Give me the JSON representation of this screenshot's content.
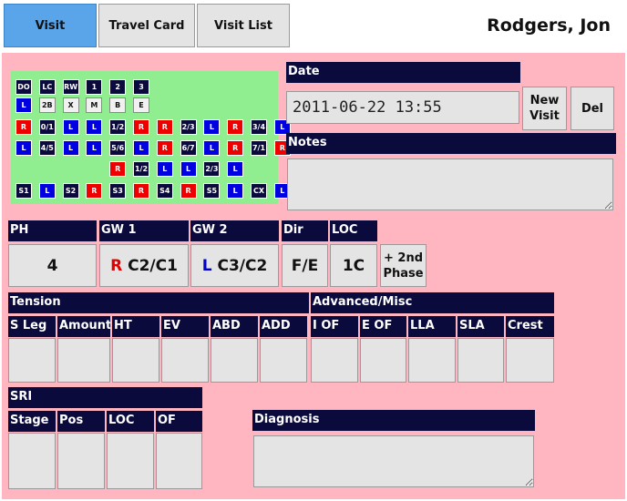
{
  "tabs": [
    {
      "label": "Visit",
      "active": true
    },
    {
      "label": "Travel Card",
      "active": false
    },
    {
      "label": "Visit List",
      "active": false
    }
  ],
  "patient_name": "Rodgers, Jon",
  "colors": {
    "accent": "#5aa5ea",
    "panel_bg": "#ffb6c1",
    "header_bg": "#0a0a3c",
    "grid_bg": "#90ee90",
    "red": "#ee0000",
    "blue": "#0000e0"
  },
  "grid": {
    "rows": [
      [
        {
          "t": "DO",
          "c": "k"
        },
        {
          "t": "LC",
          "c": "k"
        },
        {
          "t": "RW",
          "c": "k"
        },
        {
          "t": "1",
          "c": "k"
        },
        {
          "t": "2",
          "c": "k"
        },
        {
          "t": "3",
          "c": "k"
        }
      ],
      [
        {
          "t": "L",
          "c": "b"
        },
        {
          "t": "2B",
          "c": "w"
        },
        {
          "t": "X",
          "c": "w"
        },
        {
          "t": "M",
          "c": "w"
        },
        {
          "t": "B",
          "c": "w"
        },
        {
          "t": "E",
          "c": "w"
        }
      ],
      [
        {
          "t": "R",
          "c": "r"
        },
        {
          "t": "0/1",
          "c": "k"
        },
        {
          "t": "L",
          "c": "b"
        },
        {
          "t": "L",
          "c": "b"
        },
        {
          "t": "1/2",
          "c": "k"
        },
        {
          "t": "R",
          "c": "r"
        },
        {
          "t": "R",
          "c": "r"
        },
        {
          "t": "2/3",
          "c": "k"
        },
        {
          "t": "L",
          "c": "b"
        },
        {
          "t": "R",
          "c": "r"
        },
        {
          "t": "3/4",
          "c": "k"
        },
        {
          "t": "L",
          "c": "b"
        }
      ],
      [
        {
          "t": "L",
          "c": "b"
        },
        {
          "t": "4/5",
          "c": "k"
        },
        {
          "t": "L",
          "c": "b"
        },
        {
          "t": "L",
          "c": "b"
        },
        {
          "t": "5/6",
          "c": "k"
        },
        {
          "t": "L",
          "c": "b"
        },
        {
          "t": "R",
          "c": "r"
        },
        {
          "t": "6/7",
          "c": "k"
        },
        {
          "t": "L",
          "c": "b"
        },
        {
          "t": "R",
          "c": "r"
        },
        {
          "t": "7/1",
          "c": "k"
        },
        {
          "t": "R",
          "c": "r"
        }
      ],
      [
        {
          "t": "",
          "c": "none"
        },
        {
          "t": "",
          "c": "none"
        },
        {
          "t": "",
          "c": "none"
        },
        {
          "t": "",
          "c": "none"
        },
        {
          "t": "R",
          "c": "r"
        },
        {
          "t": "1/2",
          "c": "k"
        },
        {
          "t": "L",
          "c": "b"
        },
        {
          "t": "L",
          "c": "b"
        },
        {
          "t": "2/3",
          "c": "k"
        },
        {
          "t": "L",
          "c": "b"
        }
      ],
      [
        {
          "t": "S1",
          "c": "k"
        },
        {
          "t": "L",
          "c": "b"
        },
        {
          "t": "S2",
          "c": "k"
        },
        {
          "t": "R",
          "c": "r"
        },
        {
          "t": "S3",
          "c": "k"
        },
        {
          "t": "R",
          "c": "r"
        },
        {
          "t": "S4",
          "c": "k"
        },
        {
          "t": "R",
          "c": "r"
        },
        {
          "t": "S5",
          "c": "k"
        },
        {
          "t": "L",
          "c": "b"
        },
        {
          "t": "CX",
          "c": "k"
        },
        {
          "t": "L",
          "c": "b"
        }
      ]
    ]
  },
  "date": {
    "label": "Date",
    "value": "2011-06-22 13:55"
  },
  "buttons": {
    "new_visit": "New\nVisit",
    "del": "Del",
    "second_phase": "+ 2nd\nPhase"
  },
  "notes": {
    "label": "Notes",
    "value": ""
  },
  "measures": {
    "ph": {
      "label": "PH",
      "value": "4"
    },
    "gw1": {
      "label": "GW 1",
      "side": "R",
      "value": "C2/C1"
    },
    "gw2": {
      "label": "GW 2",
      "side": "L",
      "value": "C3/C2"
    },
    "dir": {
      "label": "Dir",
      "value": "F/E"
    },
    "loc": {
      "label": "LOC",
      "value": "1C"
    }
  },
  "tension": {
    "label": "Tension",
    "columns": [
      "S Leg",
      "Amount",
      "HT",
      "EV",
      "ABD",
      "ADD"
    ]
  },
  "advanced": {
    "label": "Advanced/Misc",
    "columns": [
      "I OF",
      "E OF",
      "LLA",
      "SLA",
      "Crest"
    ]
  },
  "sri": {
    "label": "SRI",
    "columns": [
      "Stage",
      "Pos",
      "LOC",
      "OF"
    ]
  },
  "diagnosis": {
    "label": "Diagnosis",
    "value": ""
  }
}
